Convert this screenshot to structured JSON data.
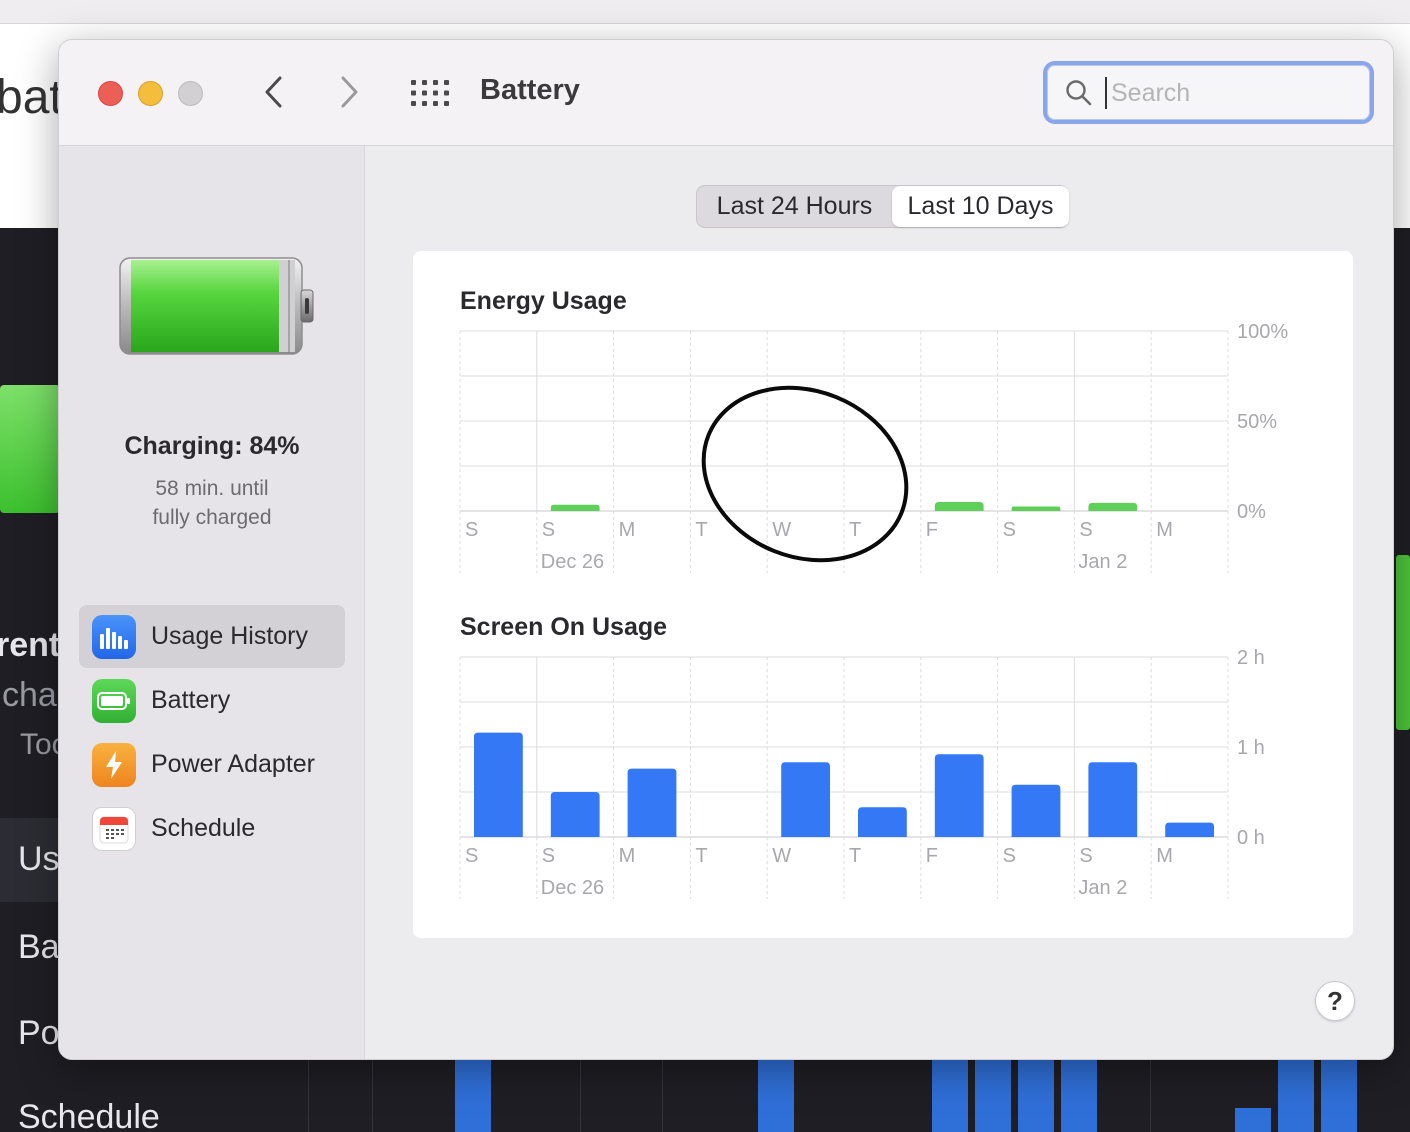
{
  "background": {
    "partial_title": "bat",
    "partial_labels": [
      "rent",
      "cha",
      "Too",
      "Us",
      "Ba",
      "Po",
      "Schedule"
    ]
  },
  "window": {
    "title": "Battery",
    "search": {
      "placeholder": "Search",
      "value": ""
    }
  },
  "sidebar": {
    "status_title": "Charging: 84%",
    "status_line1": "58 min. until",
    "status_line2": "fully charged",
    "items": [
      {
        "label": "Usage History",
        "icon": "usage-history-icon",
        "color": "#2f7cf6",
        "selected": true
      },
      {
        "label": "Battery",
        "icon": "battery-icon",
        "color": "#45c04a",
        "selected": false
      },
      {
        "label": "Power Adapter",
        "icon": "power-adapter-icon",
        "color": "#f29a2e",
        "selected": false
      },
      {
        "label": "Schedule",
        "icon": "calendar-icon",
        "color": "#ffffff",
        "selected": false
      }
    ]
  },
  "tabs": [
    {
      "label": "Last 24 Hours",
      "selected": false
    },
    {
      "label": "Last 10 Days",
      "selected": true
    }
  ],
  "chart_data": [
    {
      "type": "bar",
      "title": "Energy Usage",
      "categories": [
        "S",
        "S",
        "M",
        "T",
        "W",
        "T",
        "F",
        "S",
        "S",
        "M"
      ],
      "date_labels": [
        "",
        "Dec 26",
        "",
        "",
        "",
        "",
        "",
        "",
        "Jan 2",
        ""
      ],
      "yticks": [
        "100%",
        "50%",
        "0%"
      ],
      "ylim": [
        0,
        100
      ],
      "color": "#5ed05a",
      "values": [
        0,
        3.5,
        0,
        0,
        0,
        0,
        5,
        2.5,
        4.5,
        0
      ]
    },
    {
      "type": "bar",
      "title": "Screen On Usage",
      "categories": [
        "S",
        "S",
        "M",
        "T",
        "W",
        "T",
        "F",
        "S",
        "S",
        "M"
      ],
      "date_labels": [
        "",
        "Dec 26",
        "",
        "",
        "",
        "",
        "",
        "",
        "Jan 2",
        ""
      ],
      "yticks": [
        "2 h",
        "1 h",
        "0 h"
      ],
      "ylim": [
        0,
        2
      ],
      "color": "#3478f6",
      "values": [
        1.16,
        0.5,
        0.76,
        0,
        0.83,
        0.33,
        0.92,
        0.58,
        0.83,
        0.16
      ]
    }
  ],
  "help_label": "?"
}
